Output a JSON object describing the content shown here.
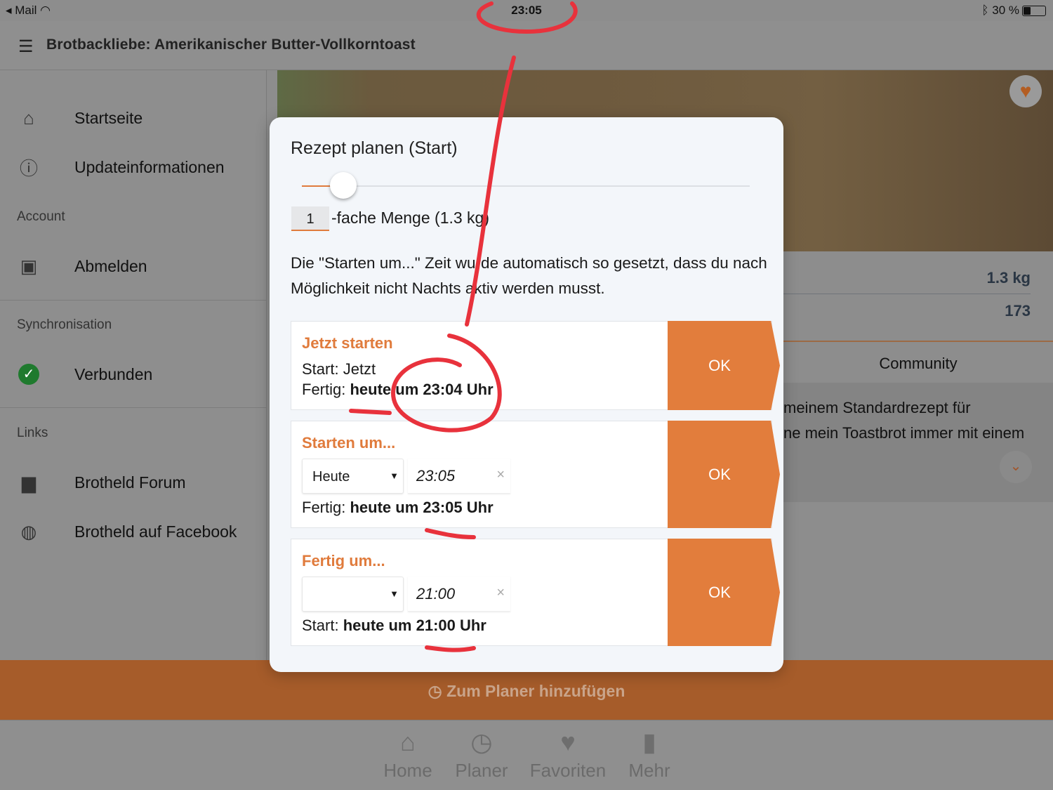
{
  "status_bar": {
    "back_app": "Mail",
    "time": "23:05",
    "battery": "30 %",
    "battery_level": 0.3
  },
  "header": {
    "title": "Brotbackliebe: Amerikanischer Butter-Vollkorntoast"
  },
  "sidebar": {
    "items": [
      {
        "label": "Startseite",
        "icon": "home-icon"
      },
      {
        "label": "Updateinformationen",
        "icon": "info-icon"
      }
    ],
    "account_header": "Account",
    "account_items": [
      {
        "label": "Abmelden",
        "icon": "account-box-icon"
      }
    ],
    "sync_header": "Synchronisation",
    "sync_items": [
      {
        "label": "Verbunden",
        "icon": "check-circle-icon"
      }
    ],
    "links_header": "Links",
    "link_items": [
      {
        "label": "Brotheld Forum",
        "icon": "forum-icon"
      },
      {
        "label": "Brotheld auf Facebook",
        "icon": "globe-icon"
      }
    ]
  },
  "recipe": {
    "weight": "1.3 kg",
    "count": "173",
    "tab_community": "Community",
    "desc_line1": "meinem Standardrezept für",
    "desc_line2": "ne mein Toastbrot immer mit einem"
  },
  "modal": {
    "title": "Rezept planen (Start)",
    "slider_value": 1,
    "quantity": "1",
    "quantity_label": "-fache Menge (1.3 kg)",
    "info": "Die \"Starten um...\" Zeit wurde automatisch so gesetzt, dass du nach Möglichkeit nicht Nachts aktiv werden musst.",
    "options": [
      {
        "heading": "Jetzt starten",
        "line1_label": "Start:",
        "line1_value": "Jetzt",
        "line2_label": "Fertig:",
        "line2_value": "heute um 23:04 Uhr",
        "ok": "OK"
      },
      {
        "heading": "Starten um...",
        "day": "Heute",
        "time": "23:05",
        "line_label": "Fertig:",
        "line_value": "heute um 23:05 Uhr",
        "ok": "OK"
      },
      {
        "heading": "Fertig um...",
        "day": "",
        "time": "21:00",
        "line_label": "Start:",
        "line_value": "heute um 21:00 Uhr",
        "ok": "OK"
      }
    ]
  },
  "planner_button": "Zum Planer hinzufügen",
  "tabbar": [
    {
      "label": "Home",
      "icon": "home-icon"
    },
    {
      "label": "Planer",
      "icon": "history-icon"
    },
    {
      "label": "Favoriten",
      "icon": "heart-icon"
    },
    {
      "label": "Mehr",
      "icon": "bookmark-icon"
    }
  ],
  "colors": {
    "accent": "#e27d3c",
    "annotation": "#e8323c"
  }
}
